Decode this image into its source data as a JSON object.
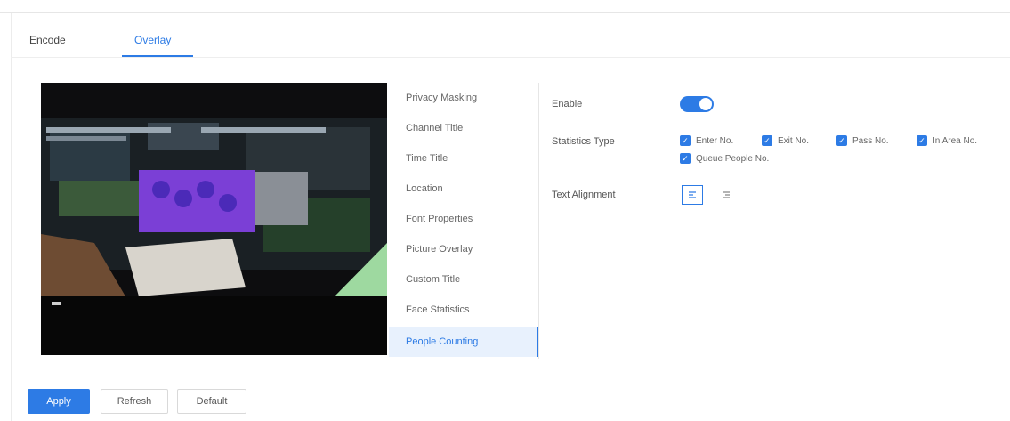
{
  "tabs": [
    {
      "label": "Encode"
    },
    {
      "label": "Overlay"
    }
  ],
  "menu": {
    "items": [
      {
        "label": "Privacy Masking"
      },
      {
        "label": "Channel Title"
      },
      {
        "label": "Time Title"
      },
      {
        "label": "Location"
      },
      {
        "label": "Font Properties"
      },
      {
        "label": "Picture Overlay"
      },
      {
        "label": "Custom Title"
      },
      {
        "label": "Face Statistics"
      },
      {
        "label": "People Counting"
      }
    ],
    "active_index": 8
  },
  "form": {
    "enable_label": "Enable",
    "enable_value": true,
    "statistics_type_label": "Statistics Type",
    "statistics_options": [
      {
        "label": "Enter No.",
        "checked": true
      },
      {
        "label": "Exit No.",
        "checked": true
      },
      {
        "label": "Pass No.",
        "checked": true
      },
      {
        "label": "In Area No.",
        "checked": true
      },
      {
        "label": "Queue People No.",
        "checked": true
      }
    ],
    "text_alignment_label": "Text Alignment",
    "alignment_options": [
      "left-align-icon",
      "right-align-icon"
    ],
    "alignment_selected": 0
  },
  "buttons": {
    "apply": "Apply",
    "refresh": "Refresh",
    "default": "Default"
  },
  "colors": {
    "accent": "#2d7be5"
  }
}
